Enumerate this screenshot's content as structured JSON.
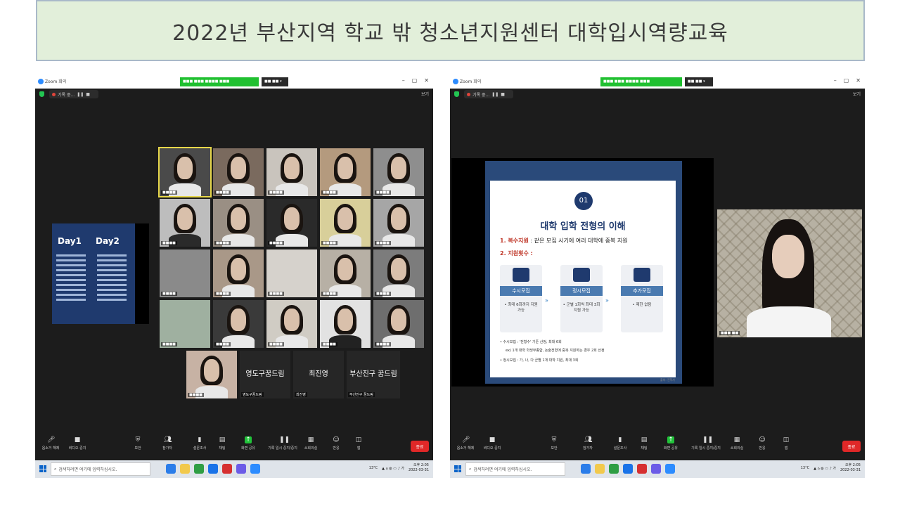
{
  "banner": {
    "title": "2022년 부산지역 학교 밖 청소년지원센터 대학입시역량교육"
  },
  "window": {
    "app_name": "Zoom 회의",
    "recording_label": "기록 중...",
    "view_label": "보기"
  },
  "gallery": {
    "slide_days": [
      "Day1",
      "Day2"
    ],
    "name_tiles": [
      "영도구꿈드림",
      "최진영",
      "부산진구 꿈드림"
    ]
  },
  "share": {
    "slide_number": "01",
    "slide_title": "대학 입학 전형의 이해",
    "point1_label": "1. 복수지원",
    "point1_text": ": 같은 모집 시기에 여러 대학에 중복 지원",
    "point2_label": "2. 지원횟수 :",
    "cards": [
      {
        "title": "수시모집",
        "body": "• 최대 6회까지 지원 가능"
      },
      {
        "title": "정시모집",
        "body": "• 군별 1회씩 최대 3회 지원 가능"
      },
      {
        "title": "추가모집",
        "body": "• 제한 없음"
      }
    ],
    "note1": "• 수시모집 : '전형수' 기준 산정, 최대 6회",
    "note1b": "ex) 1개 대학 학생부종합, 논술전형에 중복 지원하는 경우 2회 산정",
    "note2": "• 정시모집 : 가, 나, 다 군별 1개 대학 지원, 최대 3회",
    "footer": "출처: 진학사"
  },
  "toolbar": {
    "items": [
      "음소거 해제",
      "비디오 중지",
      "보안",
      "참가자",
      "설문조사",
      "채팅",
      "화면 공유",
      "기록 일시 중지/중지",
      "소회의실",
      "반응",
      "앱"
    ],
    "participants_count": "24",
    "end_label": "종료"
  },
  "taskbar": {
    "search_placeholder": "검색하려면 여기에 입력하십시오.",
    "weather": "13°C",
    "time": "오후 2:05",
    "date": "2022-03-31"
  }
}
